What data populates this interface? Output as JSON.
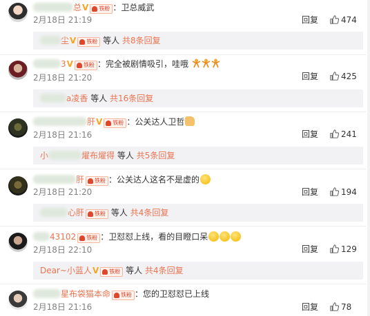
{
  "comments": [
    {
      "username": "总",
      "text": "：卫总威武",
      "time": "2月18日 21:19",
      "reply_label": "回复",
      "likes": "474",
      "thread": {
        "names": "尘",
        "suffix": "等人",
        "count_text": "共8条回复"
      }
    },
    {
      "username": "3",
      "text": "：完全被剧情吸引，哇哦",
      "time": "2月18日 21:20",
      "reply_label": "回复",
      "likes": "425",
      "thread": {
        "names": "a凌香",
        "suffix": "等人",
        "count_text": "共16条回复"
      }
    },
    {
      "username": "肝",
      "text": "：公关达人卫哲",
      "time": "2月18日 21:16",
      "reply_label": "回复",
      "likes": "241",
      "thread": {
        "names_prefix": "小",
        "names": "燿布燿得",
        "suffix": "等人",
        "count_text": "共5条回复"
      }
    },
    {
      "username": "肝",
      "text": "：公关达人这名不是虚的",
      "time": "2月18日 21:20",
      "reply_label": "回复",
      "likes": "194",
      "thread": {
        "names": "心肝",
        "suffix": "等人",
        "count_text": "共4条回复"
      }
    },
    {
      "username": "43102",
      "text": "：卫怼怼上线，看的目瞪口呆",
      "time": "2月18日 22:10",
      "reply_label": "回复",
      "likes": "129",
      "thread": {
        "names": "Dear~小蓝人",
        "suffix": "等人",
        "count_text": "共4条回复"
      }
    },
    {
      "username": "星布袋猫本命",
      "text": "：您的卫怼怼已上线",
      "time": "2月18日 21:16",
      "reply_label": "回复",
      "likes": "78"
    }
  ],
  "badge_text": "铁粉",
  "icons": {
    "verified": "v-badge-icon",
    "like": "thumbs-up-icon",
    "fan": "fan-badge-icon"
  },
  "colors": {
    "username": "#eb7350",
    "verified": "#f5a623",
    "thread_bg": "#f2f2f5"
  }
}
